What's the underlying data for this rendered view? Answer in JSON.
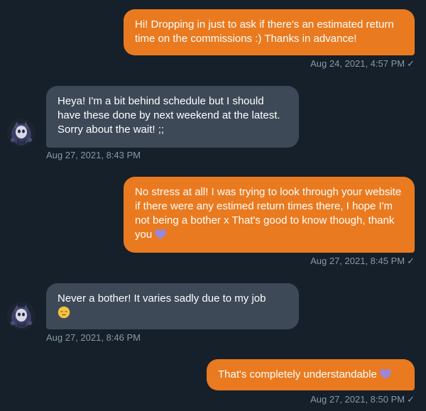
{
  "messages": [
    {
      "text": "Hi! Dropping in just to ask if there's an estimated return time on the commissions :) Thanks in advance!",
      "timestamp": "Aug 24, 2021, 4:57 PM",
      "direction": "outgoing",
      "read_icon": "checkmark-icon"
    },
    {
      "text": "Heya! I'm a bit behind schedule but I should have these done by next weekend at the latest. Sorry about the wait! ;;",
      "timestamp": "Aug 27, 2021, 8:43 PM",
      "direction": "incoming"
    },
    {
      "text": "No stress at all! I was trying to look through your website if there were any estimed return times there, I hope I'm not being a bother x That's good to know though, thank you",
      "emoji": "purple-heart-icon",
      "timestamp": "Aug 27, 2021, 8:45 PM",
      "direction": "outgoing",
      "read_icon": "checkmark-icon"
    },
    {
      "text": "Never a bother! It varies sadly due to my job",
      "emoji": "pensive-face-icon",
      "timestamp": "Aug 27, 2021, 8:46 PM",
      "direction": "incoming"
    },
    {
      "text": "That's completely understandable",
      "emoji": "purple-heart-icon",
      "timestamp": "Aug 27, 2021, 8:50 PM",
      "direction": "outgoing",
      "read_icon": "checkmark-icon"
    }
  ],
  "colors": {
    "background": "#15202b",
    "outgoing_bubble": "#ea7a1f",
    "incoming_bubble": "#3d4956",
    "timestamp": "#8899a6",
    "heart": "#9b87d6"
  }
}
